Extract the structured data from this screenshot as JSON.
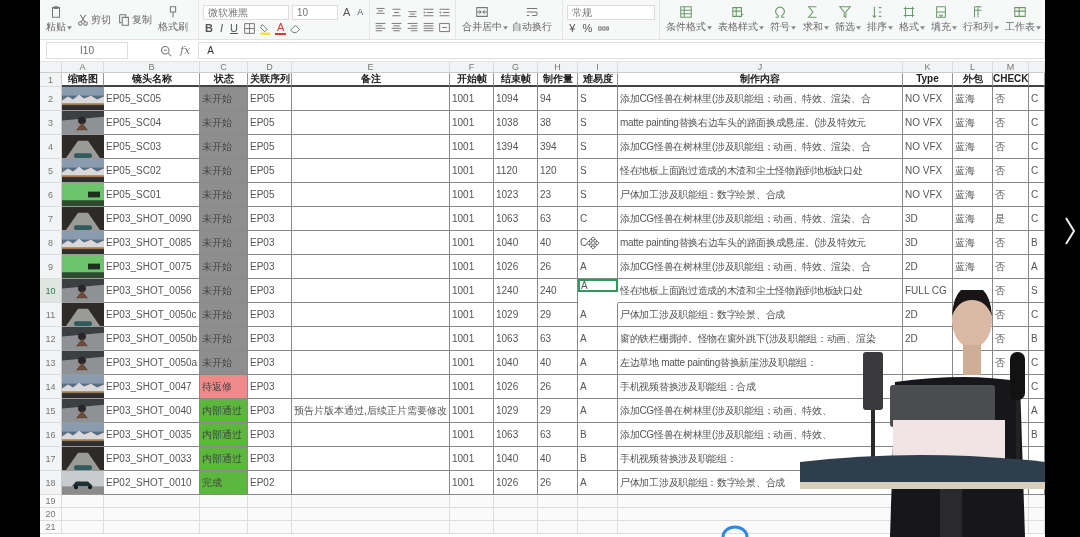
{
  "toolbar": {
    "clipboard": [
      {
        "label": "粘贴",
        "kind": "paste",
        "dropdown": true
      },
      {
        "label": "剪切",
        "kind": "cut",
        "dropdown": false
      },
      {
        "label": "复制",
        "kind": "copy",
        "dropdown": false
      },
      {
        "label": "格式刷",
        "kind": "brush",
        "dropdown": false
      }
    ],
    "font": {
      "family": "微软雅黑",
      "size": "10"
    },
    "font_size_buttons": [
      "A",
      "A"
    ],
    "style_buttons": [
      "B",
      "I",
      "U"
    ],
    "font_color_button": "A",
    "merge": [
      {
        "label": "合并居中",
        "kind": "merge",
        "dropdown": true
      },
      {
        "label": "自动换行",
        "kind": "wrap",
        "dropdown": false
      }
    ],
    "number_format": "常规",
    "number_buttons": [
      "¥",
      "%"
    ],
    "ribbon": [
      {
        "label": "条件格式",
        "kind": "conditional",
        "dropdown": true
      },
      {
        "label": "表格样式",
        "kind": "table",
        "dropdown": true
      },
      {
        "label": "符号",
        "kind": "symbol",
        "dropdown": true
      },
      {
        "label": "求和",
        "kind": "sum",
        "dropdown": true
      },
      {
        "label": "筛选",
        "kind": "filter",
        "dropdown": true
      },
      {
        "label": "排序",
        "kind": "sort",
        "dropdown": true
      },
      {
        "label": "格式",
        "kind": "format",
        "dropdown": true
      },
      {
        "label": "填充",
        "kind": "fill",
        "dropdown": true
      },
      {
        "label": "行和列",
        "kind": "rowscols",
        "dropdown": true
      },
      {
        "label": "工作表",
        "kind": "sheet",
        "dropdown": true
      }
    ]
  },
  "formula_bar": {
    "cell": "I10",
    "fx": "fx",
    "value": "A"
  },
  "sheet": {
    "column_letters": [
      "A",
      "B",
      "C",
      "D",
      "E",
      "F",
      "G",
      "H",
      "I",
      "J",
      "K",
      "L",
      "M"
    ],
    "header_row": "1",
    "headers": [
      "缩略图",
      "镜头名称",
      "状态",
      "关联序列",
      "备注",
      "开始帧",
      "结束帧",
      "制作量",
      "难易度",
      "制作内容",
      "Type",
      "外包",
      "CHECK"
    ],
    "rows": [
      {
        "row": "2",
        "shot": "EP05_SC05",
        "status": "未开始",
        "color": "#8e8e8e",
        "sequence": "EP05",
        "start": "1001",
        "end": "1094",
        "frames": "94",
        "difficulty": "S",
        "selected": false,
        "content": "添加CG怪兽在树林里(涉及职能组：动画、特效、渲染、合",
        "type": "NO VFX",
        "outsource": "蓝海",
        "check": "否",
        "column_14": "C"
      },
      {
        "row": "3",
        "shot": "EP05_SC04",
        "status": "未开始",
        "color": "#8e8e8e",
        "sequence": "EP05",
        "start": "1001",
        "end": "1038",
        "frames": "38",
        "difficulty": "S",
        "selected": false,
        "content": "matte painting替换右边车头的路面换成悬崖。(涉及特效元",
        "type": "NO VFX",
        "outsource": "蓝海",
        "check": "否",
        "column_14": "C"
      },
      {
        "row": "4",
        "shot": "EP05_SC03",
        "status": "未开始",
        "color": "#8e8e8e",
        "sequence": "EP05",
        "start": "1001",
        "end": "1394",
        "frames": "394",
        "difficulty": "S",
        "selected": false,
        "content": "添加CG怪兽在树林里(涉及职能组：动画、特效、渲染、合",
        "type": "NO VFX",
        "outsource": "蓝海",
        "check": "否",
        "column_14": "C"
      },
      {
        "row": "5",
        "shot": "EP05_SC02",
        "status": "未开始",
        "color": "#8e8e8e",
        "sequence": "EP05",
        "start": "1001",
        "end": "1120",
        "frames": "120",
        "difficulty": "S",
        "selected": false,
        "content": "怪在地板上面跑过造成的木渣和尘土怪物跑到地板缺口处",
        "type": "NO VFX",
        "outsource": "蓝海",
        "check": "否",
        "column_14": "C"
      },
      {
        "row": "6",
        "shot": "EP05_SC01",
        "status": "未开始",
        "color": "#8e8e8e",
        "sequence": "EP05",
        "start": "1001",
        "end": "1023",
        "frames": "23",
        "difficulty": "S",
        "selected": false,
        "content": "尸体加工涉及职能组：数字绘景、合成",
        "type": "NO VFX",
        "outsource": "蓝海",
        "check": "否",
        "column_14": "C"
      },
      {
        "row": "7",
        "shot": "EP03_SHOT_0090",
        "status": "未开始",
        "color": "#8e8e8e",
        "sequence": "EP03",
        "start": "1001",
        "end": "1063",
        "frames": "63",
        "difficulty": "C",
        "selected": false,
        "content": "添加CG怪兽在树林里(涉及职能组：动画、特效、渲染、合",
        "type": "3D",
        "outsource": "蓝海",
        "check": "是",
        "column_14": "C"
      },
      {
        "row": "8",
        "shot": "EP03_SHOT_0085",
        "status": "未开始",
        "color": "#8e8e8e",
        "sequence": "EP03",
        "start": "1001",
        "end": "1040",
        "frames": "40",
        "difficulty": "C",
        "selected": false,
        "content": "matte painting替换右边车头的路面换成悬崖。(涉及特效元",
        "type": "3D",
        "outsource": "蓝海",
        "check": "否",
        "column_14": "B"
      },
      {
        "row": "9",
        "shot": "EP03_SHOT_0075",
        "status": "未开始",
        "color": "#8e8e8e",
        "sequence": "EP03",
        "start": "1001",
        "end": "1026",
        "frames": "26",
        "difficulty": "A",
        "selected": false,
        "content": "添加CG怪兽在树林里(涉及职能组：动画、特效、渲染、合",
        "type": "2D",
        "outsource": "蓝海",
        "check": "否",
        "column_14": "A"
      },
      {
        "row": "10",
        "shot": "EP03_SHOT_0056",
        "status": "未开始",
        "color": "#8e8e8e",
        "sequence": "EP03",
        "start": "1001",
        "end": "1240",
        "frames": "240",
        "difficulty": "A",
        "selected": true,
        "content": "怪在地板上面跑过造成的木渣和尘土怪物跑到地板缺口处",
        "type": "FULL CG",
        "check": "否",
        "column_14": "S"
      },
      {
        "row": "11",
        "shot": "EP03_SHOT_0050c",
        "status": "未开始",
        "color": "#8e8e8e",
        "sequence": "EP03",
        "start": "1001",
        "end": "1029",
        "frames": "29",
        "difficulty": "A",
        "selected": false,
        "content": "尸体加工涉及职能组：数字绘景、合成",
        "type": "2D",
        "check": "否",
        "column_14": "C"
      },
      {
        "row": "12",
        "shot": "EP03_SHOT_0050b",
        "status": "未开始",
        "color": "#8e8e8e",
        "sequence": "EP03",
        "start": "1001",
        "end": "1063",
        "frames": "63",
        "difficulty": "A",
        "selected": false,
        "content": "窗的铁栏栅撕掉。怪物在窗外跳下(涉及职能组：动画、渲染",
        "type": "2D",
        "check": "否",
        "column_14": "B"
      },
      {
        "row": "13",
        "shot": "EP03_SHOT_0050a",
        "status": "未开始",
        "color": "#8e8e8e",
        "sequence": "EP03",
        "start": "1001",
        "end": "1040",
        "frames": "40",
        "difficulty": "A",
        "selected": false,
        "content": "左边草地 matte painting替换新崖涉及职能组：",
        "check": "否",
        "column_14": "C"
      },
      {
        "row": "14",
        "shot": "EP03_SHOT_0047",
        "status": "待返修",
        "color": "#f08a8a",
        "sequence": "EP03",
        "start": "1001",
        "end": "1026",
        "frames": "26",
        "difficulty": "A",
        "selected": false,
        "content": "手机视频替换涉及职能组：合成",
        "column_14": "C"
      },
      {
        "row": "15",
        "shot": "EP03_SHOT_0040",
        "status": "内部通过",
        "color": "#5cb83c",
        "sequence": "EP03",
        "note": "预告片版本通过,后续正片需要修改",
        "start": "1001",
        "end": "1029",
        "frames": "29",
        "difficulty": "A",
        "selected": false,
        "content": "添加CG怪兽在树林里(涉及职能组：动画、特效、",
        "column_14": "A"
      },
      {
        "row": "16",
        "shot": "EP03_SHOT_0035",
        "status": "内部通过",
        "color": "#5cb83c",
        "sequence": "EP03",
        "start": "1001",
        "end": "1063",
        "frames": "63",
        "difficulty": "B",
        "selected": false,
        "content": "添加CG怪兽在树林里(涉及职能组：动画、特效、",
        "column_14": "B"
      },
      {
        "row": "17",
        "shot": "EP03_SHOT_0033",
        "status": "内部通过",
        "color": "#5cb83c",
        "sequence": "EP03",
        "start": "1001",
        "end": "1040",
        "frames": "40",
        "difficulty": "B",
        "selected": false,
        "content": "手机视频替换涉及职能组："
      },
      {
        "row": "18",
        "shot": "EP02_SHOT_0010",
        "status": "完成",
        "color": "#5cb83c",
        "sequence": "EP02",
        "start": "1001",
        "end": "1026",
        "frames": "26",
        "difficulty": "A",
        "selected": false,
        "content": "尸体加工涉及职能组：数字绘景、合成"
      }
    ],
    "empty_rows": [
      "19",
      "20",
      "21"
    ]
  }
}
